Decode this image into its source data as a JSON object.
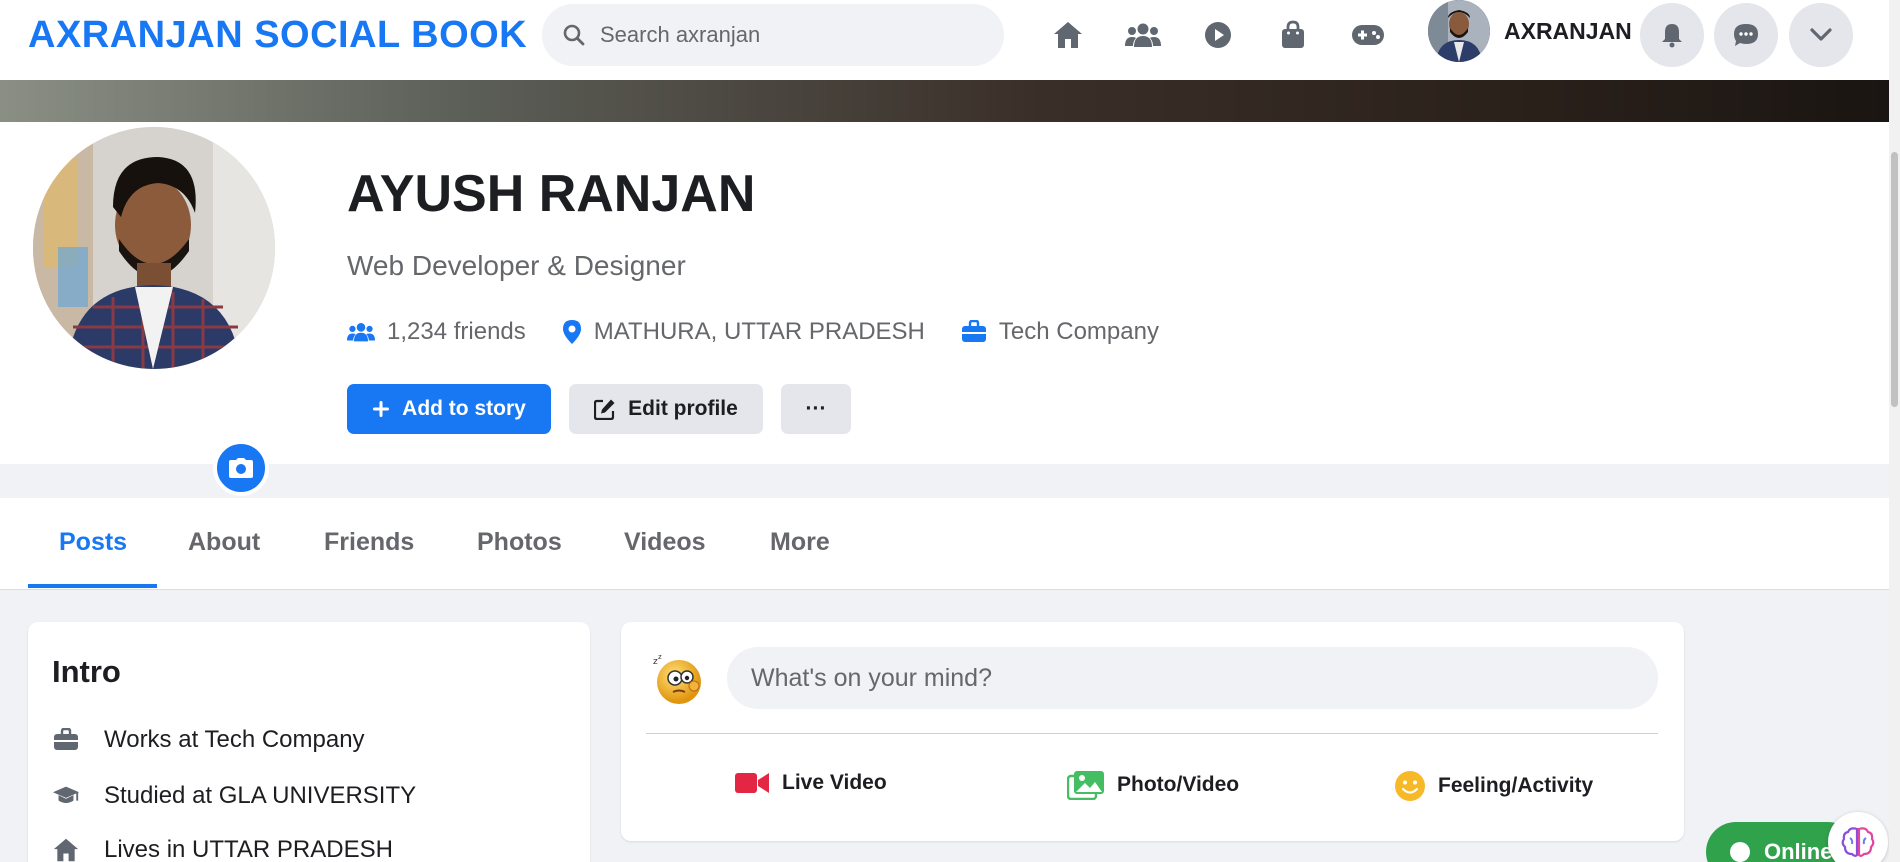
{
  "header": {
    "brand": "AXRANJAN SOCIAL BOOK",
    "search_placeholder": "Search axranjan",
    "nav_icons": [
      "home-icon",
      "friends-icon",
      "watch-icon",
      "marketplace-icon",
      "gaming-icon"
    ],
    "username": "AXRANJAN",
    "right_icons": [
      "bell-icon",
      "messenger-icon",
      "chevron-down-icon"
    ]
  },
  "profile": {
    "name": "AYUSH RANJAN",
    "tagline": "Web Developer & Designer",
    "friends_count": "1,234 friends",
    "location": "MATHURA, UTTAR PRADESH",
    "workplace": "Tech Company",
    "add_story_label": "Add to story",
    "edit_profile_label": "Edit profile",
    "more_label": "···"
  },
  "tabs": [
    {
      "label": "Posts",
      "active": true
    },
    {
      "label": "About",
      "active": false
    },
    {
      "label": "Friends",
      "active": false
    },
    {
      "label": "Photos",
      "active": false
    },
    {
      "label": "Videos",
      "active": false
    },
    {
      "label": "More",
      "active": false
    }
  ],
  "intro": {
    "title": "Intro",
    "items": [
      {
        "icon": "briefcase-icon",
        "text": "Works at Tech Company"
      },
      {
        "icon": "graduation-cap-icon",
        "text": "Studied at GLA UNIVERSITY"
      },
      {
        "icon": "home-icon",
        "text": "Lives in UTTAR PRADESH"
      }
    ]
  },
  "composer": {
    "placeholder": "What's on your mind?",
    "actions": [
      {
        "icon": "live-video-icon",
        "label": "Live Video",
        "color": "#e42645"
      },
      {
        "icon": "photo-icon",
        "label": "Photo/Video",
        "color": "#45bd62"
      },
      {
        "icon": "smiley-icon",
        "label": "Feeling/Activity",
        "color": "#f7b928"
      }
    ]
  },
  "status": {
    "online_label": "Online"
  },
  "colors": {
    "accent": "#1877f2",
    "online": "#31a24c",
    "surface": "#ffffff",
    "background": "#f0f2f5"
  }
}
